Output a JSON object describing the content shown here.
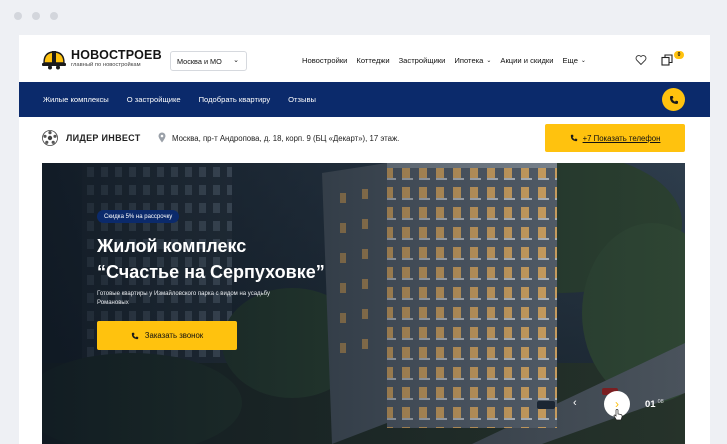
{
  "logo": {
    "title": "НОВОСТРОЕВ",
    "subtitle": "главный по новостройкам"
  },
  "city_select": {
    "value": "Москва и  МО"
  },
  "top_nav": [
    {
      "label": "Новостройки",
      "has_dropdown": false
    },
    {
      "label": "Коттеджи",
      "has_dropdown": false
    },
    {
      "label": "Застройщики",
      "has_dropdown": false
    },
    {
      "label": "Ипотека",
      "has_dropdown": true
    },
    {
      "label": "Акции и скидки",
      "has_dropdown": false
    },
    {
      "label": "Еще",
      "has_dropdown": true
    }
  ],
  "compare_badge": "0",
  "secondary_nav": [
    "Жилые комплексы",
    "О застройщике",
    "Подобрать квартиру",
    "Отзывы"
  ],
  "developer": {
    "name": "ЛИДЕР ИНВЕСТ",
    "address": "Москва, пр-т Андропова, д. 18, корп. 9 (БЦ «Декарт»), 17 этаж.",
    "phone_button": "+7 Показать телефон"
  },
  "hero": {
    "discount_badge": "Скидка 5% на рассрочку",
    "title_line1": "Жилой комплекс",
    "title_line2": "“Счастье на Серпуховке”",
    "description": "Готовые квартиры у Измайловского парка с видом на усадьбу Романовых",
    "callback_button": "Заказать звонок",
    "slide_current": "01",
    "slide_total": "08"
  },
  "icons": {
    "heart": "heart-icon",
    "compare": "compare-icon",
    "phone": "phone-icon",
    "pin": "location-pin-icon",
    "prev": "chevron-left-icon",
    "next": "chevron-right-icon"
  },
  "colors": {
    "accent": "#ffc20e",
    "navy": "#0b2a6b",
    "page_bg": "#eef0f4"
  }
}
